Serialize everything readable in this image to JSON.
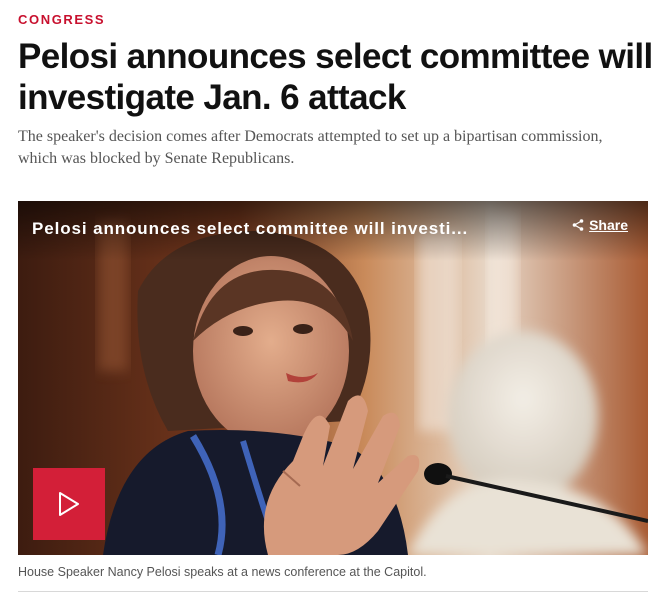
{
  "article": {
    "section": "CONGRESS",
    "headline": "Pelosi announces select committee will investigate Jan. 6 attack",
    "dek": "The speaker's decision comes after Democrats attempted to set up a bipartisan commission, which was blocked by Senate Republicans."
  },
  "video": {
    "title": "Pelosi announces select committee will investi...",
    "share_label": "Share",
    "share_icon": "share-icon",
    "play_icon": "play-icon",
    "caption": "House Speaker Nancy Pelosi speaks at a news conference at the Capitol."
  },
  "colors": {
    "accent": "#c8102e",
    "play_button": "#d31f38",
    "headline": "#111111",
    "dek": "#555555"
  }
}
